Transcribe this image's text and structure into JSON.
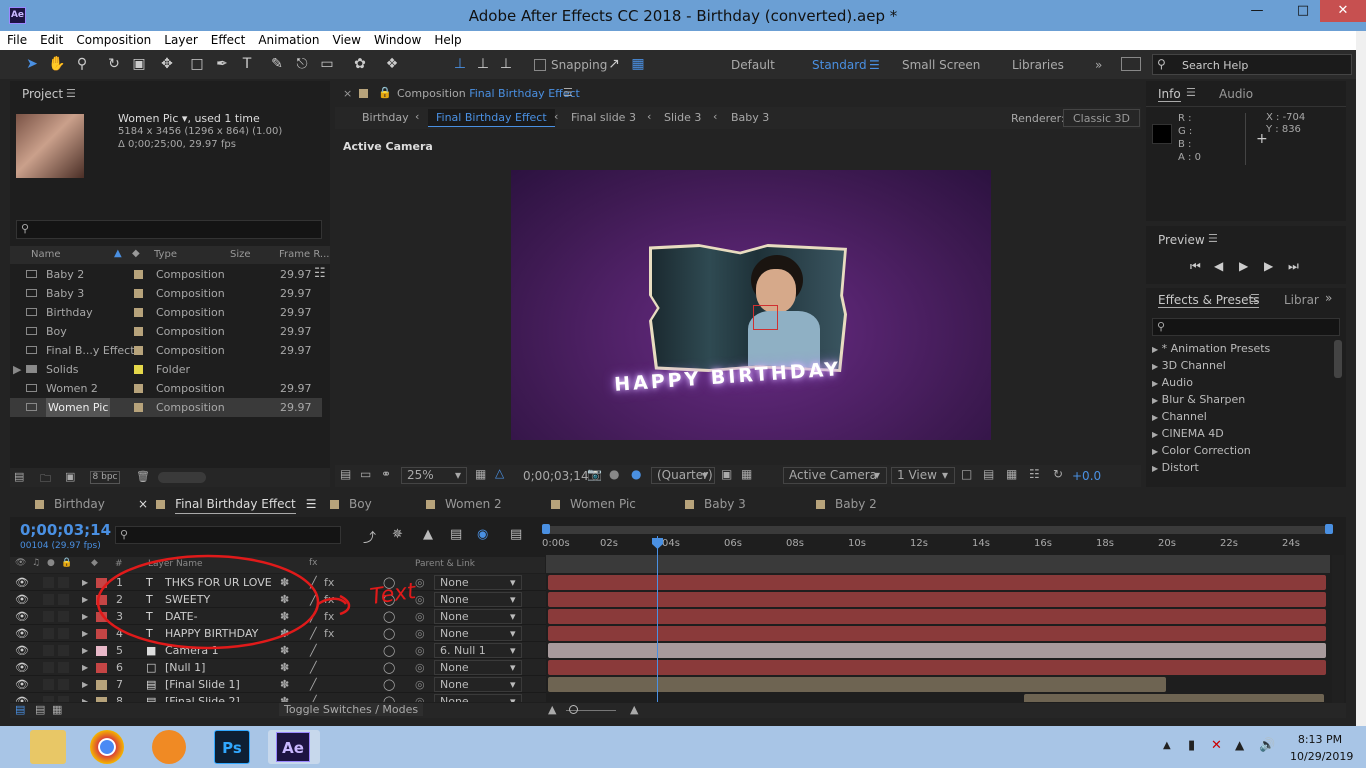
{
  "window": {
    "title": "Adobe After Effects CC 2018 - Birthday (converted).aep *",
    "app_icon": "Ae"
  },
  "menu": [
    "File",
    "Edit",
    "Composition",
    "Layer",
    "Effect",
    "Animation",
    "View",
    "Window",
    "Help"
  ],
  "toolbar": {
    "snapping": "Snapping",
    "workspaces": [
      "Default",
      "Standard",
      "Small Screen",
      "Libraries"
    ],
    "active_workspace": "Standard",
    "search_help": "Search Help"
  },
  "project": {
    "tab": "Project",
    "item_name": "Women Pic",
    "item_used": ", used 1 time",
    "item_dims": "5184 x 3456  (1296 x 864) (1.00)",
    "item_dur": "Δ 0;00;25;00, 29.97 fps",
    "columns": [
      "Name",
      "Type",
      "Size",
      "Frame R..."
    ],
    "rows": [
      {
        "name": "Baby 2",
        "type": "Composition",
        "fps": "29.97",
        "color": "#b7a37b"
      },
      {
        "name": "Baby 3",
        "type": "Composition",
        "fps": "29.97",
        "color": "#b7a37b"
      },
      {
        "name": "Birthday",
        "type": "Composition",
        "fps": "29.97",
        "color": "#b7a37b"
      },
      {
        "name": "Boy",
        "type": "Composition",
        "fps": "29.97",
        "color": "#b7a37b"
      },
      {
        "name": "Final B...y Effect",
        "type": "Composition",
        "fps": "29.97",
        "color": "#b7a37b"
      },
      {
        "name": "Solids",
        "type": "Folder",
        "fps": "",
        "color": "#e5d84a"
      },
      {
        "name": "Women 2",
        "type": "Composition",
        "fps": "29.97",
        "color": "#b7a37b"
      },
      {
        "name": "Women Pic",
        "type": "Composition",
        "fps": "29.97",
        "color": "#b7a37b"
      }
    ],
    "bpc": "8 bpc"
  },
  "comp": {
    "tab_prefix": "Composition",
    "tab_name": "Final Birthday Effect",
    "breadcrumbs": [
      "Birthday",
      "Final Birthday Effect",
      "Final slide 3",
      "Slide 3",
      "Baby 3"
    ],
    "renderer_label": "Renderer:",
    "renderer": "Classic 3D",
    "view_label": "Active Camera",
    "overlay_text": "HAPPY BIRTHDAY",
    "zoom": "25%",
    "timecode": "0;00;03;14",
    "resolution": "(Quarter)",
    "camera": "Active Camera",
    "views": "1 View",
    "exposure": "+0.0"
  },
  "info": {
    "tab": "Info",
    "tab2": "Audio",
    "r": "R :",
    "g": "G :",
    "b": "B :",
    "a": "A : 0",
    "x": "X : -704",
    "y": "Y : 836"
  },
  "preview": {
    "tab": "Preview"
  },
  "effects": {
    "tab": "Effects & Presets",
    "tab2": "Librar",
    "items": [
      "* Animation Presets",
      "3D Channel",
      "Audio",
      "Blur & Sharpen",
      "Channel",
      "CINEMA 4D",
      "Color Correction",
      "Distort"
    ]
  },
  "timeline": {
    "tabs": [
      {
        "name": "Birthday",
        "color": "#b7a37b"
      },
      {
        "name": "Final Birthday Effect",
        "color": "#b7a37b"
      },
      {
        "name": "Boy",
        "color": "#b7a37b"
      },
      {
        "name": "Women 2",
        "color": "#b7a37b"
      },
      {
        "name": "Women Pic",
        "color": "#b7a37b"
      },
      {
        "name": "Baby 3",
        "color": "#b7a37b"
      },
      {
        "name": "Baby 2",
        "color": "#b7a37b"
      }
    ],
    "timecode": "0;00;03;14",
    "frame": "00104 (29.97 fps)",
    "col_layer": "Layer Name",
    "col_num": "#",
    "col_parent": "Parent & Link",
    "ruler": [
      "0:00s",
      "02s",
      "04s",
      "06s",
      "08s",
      "10s",
      "12s",
      "14s",
      "16s",
      "18s",
      "20s",
      "22s",
      "24s"
    ],
    "layers": [
      {
        "num": "1",
        "type": "T",
        "name": "THKS FOR UR LOVE",
        "parent": "None",
        "color": "#c54545"
      },
      {
        "num": "2",
        "type": "T",
        "name": "SWEETY",
        "parent": "None",
        "color": "#c54545"
      },
      {
        "num": "3",
        "type": "T",
        "name": "DATE-",
        "parent": "None",
        "color": "#c54545"
      },
      {
        "num": "4",
        "type": "T",
        "name": "HAPPY BIRTHDAY",
        "parent": "None",
        "color": "#c54545"
      },
      {
        "num": "5",
        "type": "cam",
        "name": "Camera 1",
        "parent": "6. Null 1",
        "color": "#e8b8c8"
      },
      {
        "num": "6",
        "type": "null",
        "name": "[Null 1]",
        "parent": "None",
        "color": "#c54545"
      },
      {
        "num": "7",
        "type": "comp",
        "name": "[Final Slide 1]",
        "parent": "None",
        "color": "#b7a37b"
      },
      {
        "num": "8",
        "type": "comp",
        "name": "[Final Slide 2]",
        "parent": "None",
        "color": "#b7a37b"
      }
    ],
    "annotation": "Text",
    "toggle": "Toggle Switches / Modes"
  },
  "taskbar": {
    "time": "8:13 PM",
    "date": "10/29/2019"
  }
}
